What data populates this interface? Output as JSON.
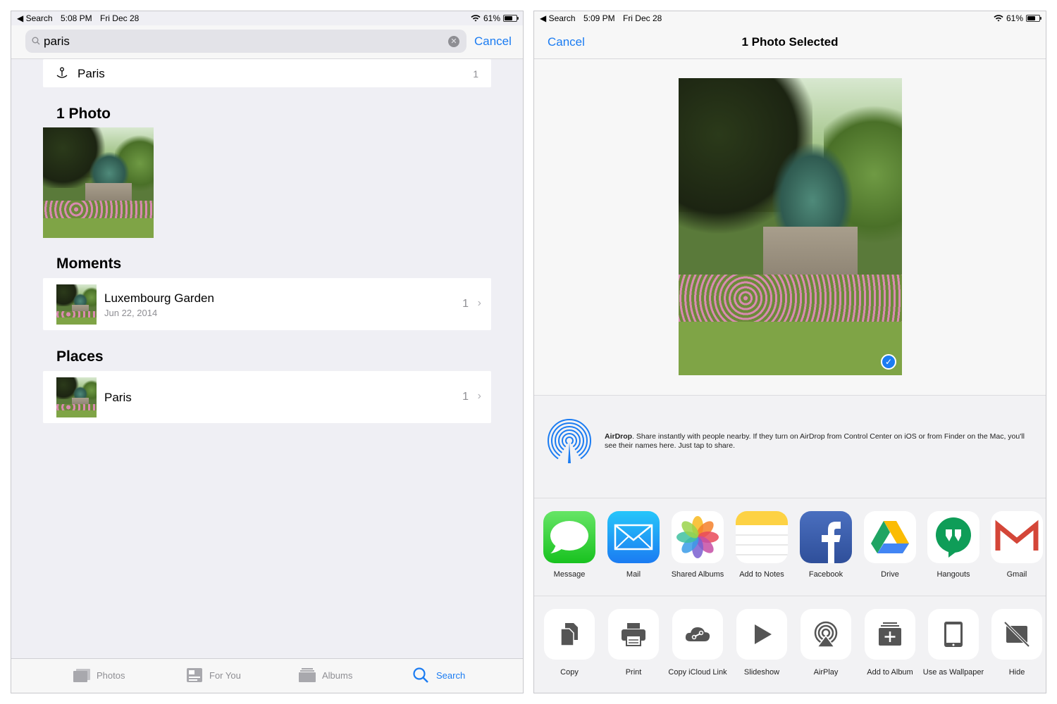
{
  "status_left": {
    "back": "◀ Search",
    "time": "5:08 PM",
    "date": "Fri Dec 28",
    "battery": "61%",
    "battery_level": 0.61
  },
  "status_right": {
    "back": "◀ Search",
    "time": "5:09 PM",
    "date": "Fri Dec 28",
    "battery": "61%",
    "battery_level": 0.61
  },
  "search": {
    "value": "paris",
    "cancel_label": "Cancel"
  },
  "top_result": {
    "title": "Paris",
    "count": "1"
  },
  "photos_section": {
    "title": "1 Photo"
  },
  "moments_section": {
    "title": "Moments",
    "item": {
      "title": "Luxembourg Garden",
      "date": "Jun 22, 2014",
      "count": "1"
    }
  },
  "places_section": {
    "title": "Places",
    "item": {
      "title": "Paris",
      "count": "1"
    }
  },
  "tabbar": {
    "photos": "Photos",
    "for_you": "For You",
    "albums": "Albums",
    "search": "Search"
  },
  "share": {
    "cancel_label": "Cancel",
    "title": "1 Photo Selected",
    "airdrop_title": "AirDrop",
    "airdrop_text": ". Share instantly with people nearby. If they turn on AirDrop from Control Center on iOS or from Finder on the Mac, you'll see their names here. Just tap to share.",
    "apps": [
      "Message",
      "Mail",
      "Shared Albums",
      "Add to Notes",
      "Facebook",
      "Drive",
      "Hangouts",
      "Gmail"
    ],
    "actions": [
      "Copy",
      "Print",
      "Copy iCloud Link",
      "Slideshow",
      "AirPlay",
      "Add to Album",
      "Use as Wallpaper",
      "Hide"
    ]
  },
  "colors": {
    "accent": "#1b7cf2",
    "background": "#efeff4"
  }
}
